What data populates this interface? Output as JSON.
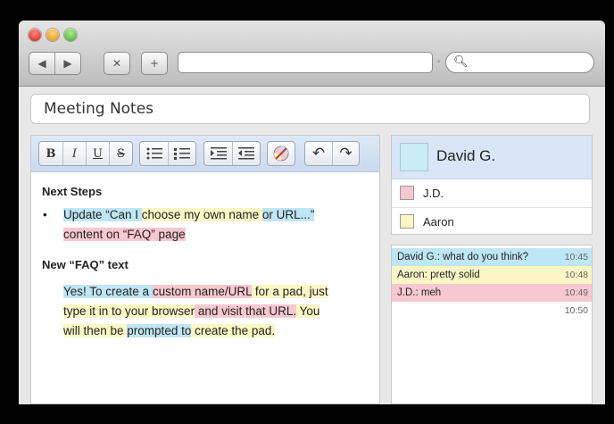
{
  "toolbar": {
    "back_icon": "◀",
    "forward_icon": "▶",
    "stop_icon": "✕",
    "add_icon": "+",
    "url_value": "",
    "search_value": ""
  },
  "pad": {
    "title": "Meeting Notes"
  },
  "editor_toolbar": {
    "bold": "B",
    "italic": "I",
    "underline": "U",
    "strikethrough": "S",
    "undo": "↶",
    "redo": "↷"
  },
  "document": {
    "heading1": "Next Steps",
    "bullet_bullet": "•",
    "bullet_parts": [
      "Update “Can I ",
      "choose my own name ",
      "or URL...” ",
      "content on “FAQ” page"
    ],
    "heading2": "New “FAQ” text",
    "body_parts": [
      "Yes! To create a ",
      "custom name/URL",
      " for a pad, just ",
      "type it in to your browser",
      " and visit that URL.",
      " You ",
      "will then be ",
      "prompted to",
      " create the pad."
    ]
  },
  "users": {
    "me": {
      "name": "David G.",
      "color": "#c9ecf7"
    },
    "others": [
      {
        "name": "J.D.",
        "color": "#f7c8cf"
      },
      {
        "name": "Aaron",
        "color": "#fbf7c5"
      }
    ]
  },
  "chat": {
    "messages": [
      {
        "text": "David G.: what do you think?",
        "time": "10:45",
        "color": "#bfe6f4"
      },
      {
        "text": "Aaron: pretty solid",
        "time": "10:48",
        "color": "#fbf7c5"
      },
      {
        "text": "J.D.: meh",
        "time": "10:49",
        "color": "#f7c8cf"
      },
      {
        "text": "",
        "time": "10:50",
        "color": "#ffffff"
      }
    ]
  },
  "colors": {
    "blue_highlight": "#bfe6f4",
    "yellow_highlight": "#fbf7c5",
    "pink_highlight": "#f7c8cf"
  }
}
